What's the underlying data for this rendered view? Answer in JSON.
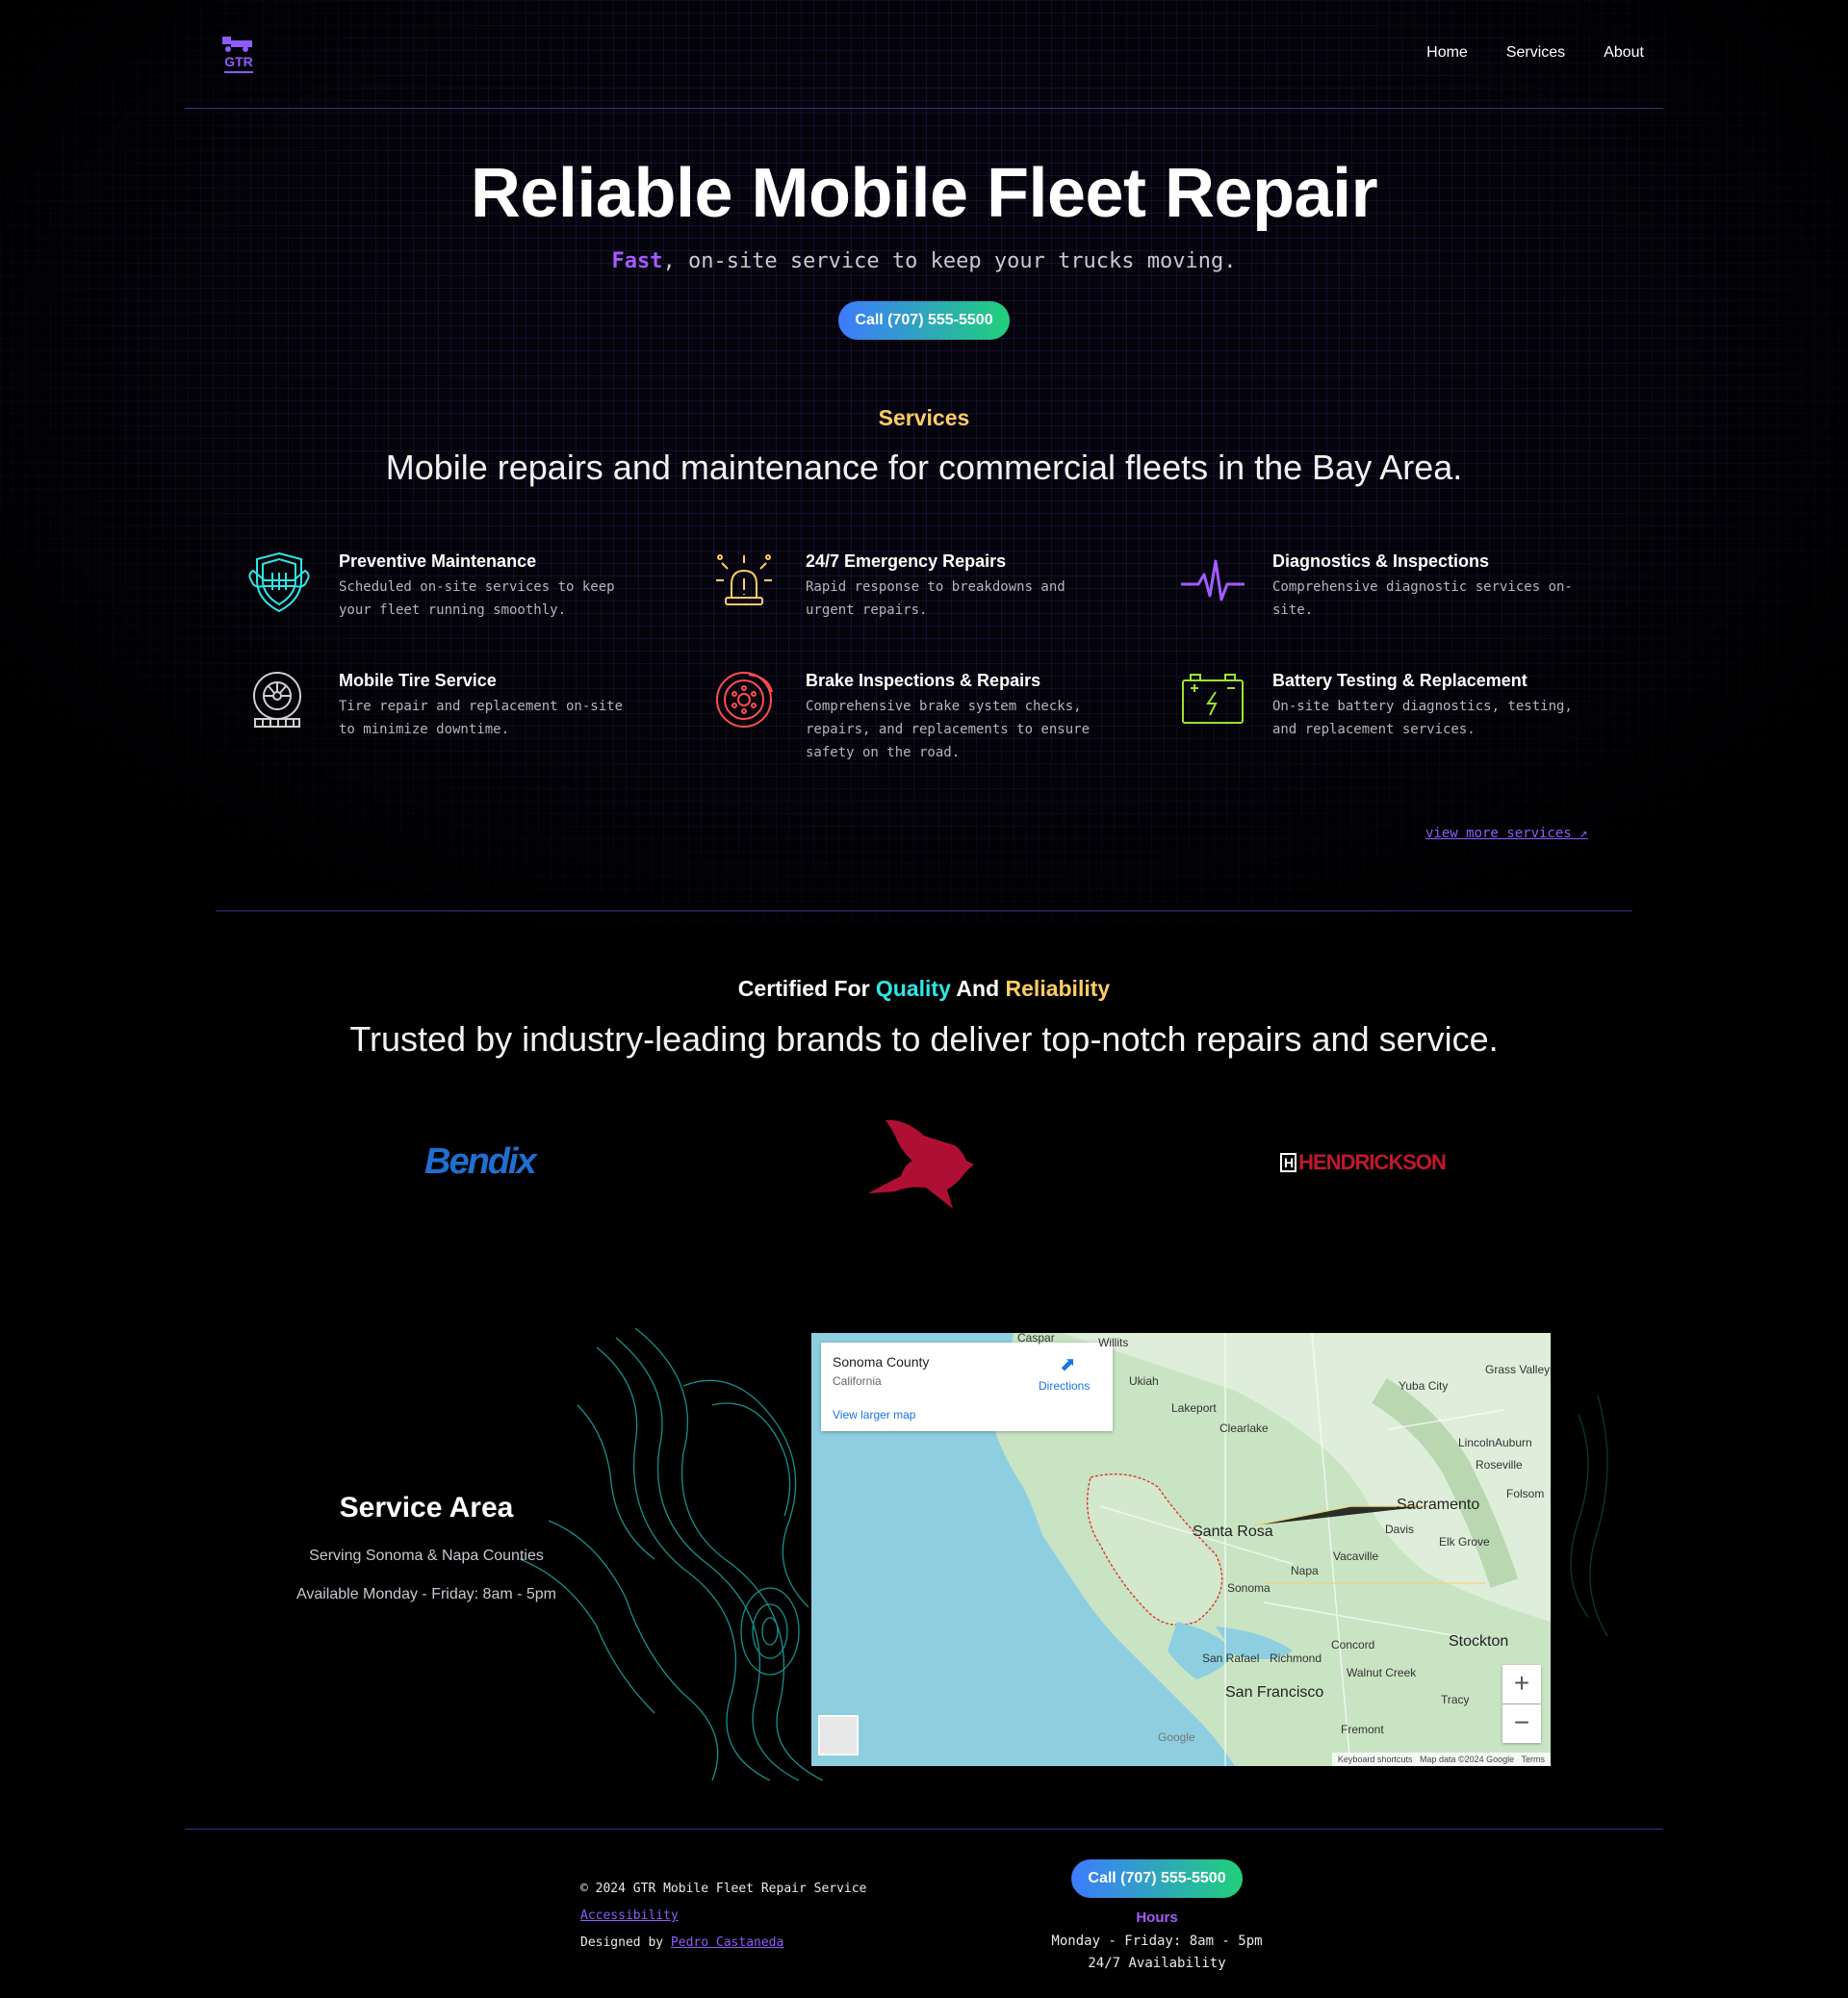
{
  "header": {
    "logo_text": "GTR",
    "nav": [
      "Home",
      "Services",
      "About"
    ]
  },
  "hero": {
    "title": "Reliable Mobile Fleet Repair",
    "subtitle_accent": "Fast",
    "subtitle_rest": ", on-site service to keep your trucks moving.",
    "cta": "Call (707) 555-5500"
  },
  "services": {
    "label": "Services",
    "heading": "Mobile repairs and maintenance for commercial fleets in the Bay Area.",
    "items": [
      {
        "icon": "shield-wrench-icon",
        "title": "Preventive Maintenance",
        "desc": "Scheduled on-site services to keep your fleet running smoothly."
      },
      {
        "icon": "siren-icon",
        "title": "24/7 Emergency Repairs",
        "desc": "Rapid response to breakdowns and urgent repairs."
      },
      {
        "icon": "heartbeat-icon",
        "title": "Diagnostics & Inspections",
        "desc": "Comprehensive diagnostic services on-site."
      },
      {
        "icon": "tire-icon",
        "title": "Mobile Tire Service",
        "desc": "Tire repair and replacement on-site to minimize downtime."
      },
      {
        "icon": "brake-disc-icon",
        "title": "Brake Inspections & Repairs",
        "desc": "Comprehensive brake system checks, repairs, and replacements to ensure safety on the road."
      },
      {
        "icon": "battery-icon",
        "title": "Battery Testing & Replacement",
        "desc": "On-site battery diagnostics, testing, and replacement services."
      }
    ],
    "more_link": "view more services"
  },
  "certified": {
    "label_a": "Certified For ",
    "label_b": "Quality",
    "label_c": " And ",
    "label_d": "Reliability",
    "heading": "Trusted by industry-leading brands to deliver top-notch repairs and service.",
    "brands": [
      "Bendix",
      "HENDRICKSON"
    ]
  },
  "service_area": {
    "title": "Service Area",
    "line1": "Serving Sonoma & Napa Counties",
    "line2": "Available Monday - Friday: 8am - 5pm"
  },
  "map": {
    "place": "Sonoma County",
    "region": "California",
    "directions": "Directions",
    "larger": "View larger map",
    "labels": {
      "caspar": "Caspar",
      "willits": "Willits",
      "ukiah": "Ukiah",
      "lakeport": "Lakeport",
      "clearlake": "Clearlake",
      "yuba": "Yuba City",
      "grass": "Grass Valley",
      "lincoln": "Lincoln",
      "auburn": "Auburn",
      "roseville": "Roseville",
      "folsom": "Folsom",
      "sacramento": "Sacramento",
      "davis": "Davis",
      "elk": "Elk Grove",
      "vacaville": "Vacaville",
      "santarosa": "Santa Rosa",
      "napa": "Napa",
      "sonoma": "Sonoma",
      "sanrafael": "San Rafael",
      "richmond": "Richmond",
      "concord": "Concord",
      "walnut": "Walnut Creek",
      "stockton": "Stockton",
      "sf": "San Francisco",
      "tracy": "Tracy",
      "fremont": "Fremont",
      "google": "Google"
    },
    "attribution": "Keyboard shortcuts   Map data ©2024 Google   Terms",
    "zoom_in": "+",
    "zoom_out": "−"
  },
  "footer": {
    "copyright": "© 2024 GTR Mobile Fleet Repair Service",
    "accessibility": "Accessibility",
    "designed_by": "Designed by ",
    "designer": "Pedro Castaneda",
    "cta": "Call (707) 555-5500",
    "hours_label": "Hours",
    "hours_line": "Monday - Friday: 8am - 5pm",
    "availability": "24/7 Availability"
  },
  "colors": {
    "accent_purple": "#a35cff",
    "accent_teal": "#2ee6e6",
    "accent_gold": "#ffcc66",
    "divider": "#3d2f88"
  }
}
